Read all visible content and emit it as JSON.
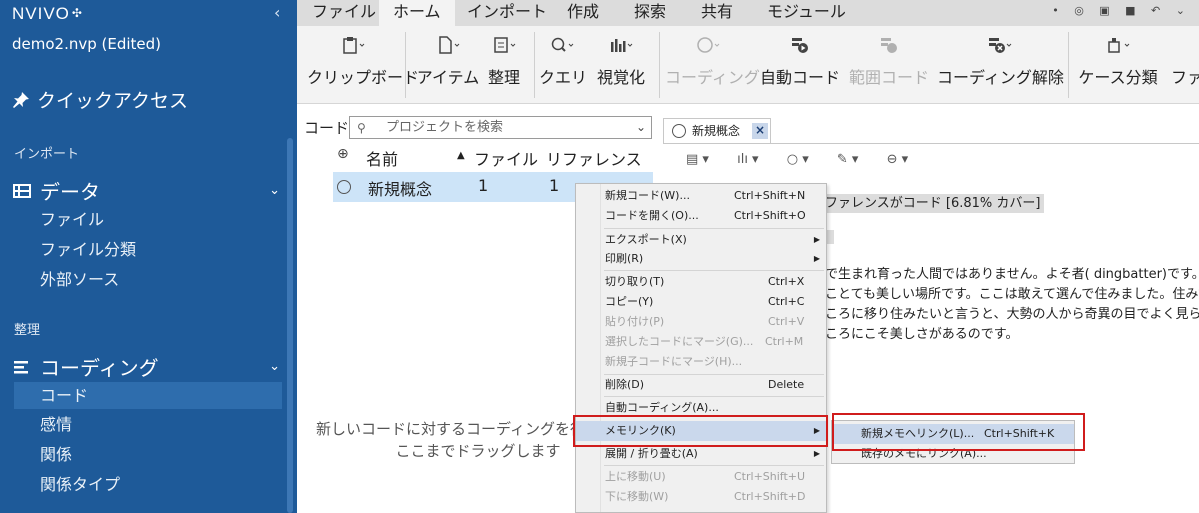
{
  "app": {
    "brand": "NVIVO",
    "project": "demo2.nvp (Edited)"
  },
  "sidebar": {
    "quick_access": "クイックアクセス",
    "section_import": "インポート",
    "group_data": "データ",
    "data_items": [
      "ファイル",
      "ファイル分類",
      "外部ソース"
    ],
    "section_organize": "整理",
    "group_coding": "コーディング",
    "coding_items": [
      "コード",
      "感情",
      "関係",
      "関係タイプ"
    ],
    "selected_item": "コード"
  },
  "tabs": [
    "ファイル",
    "ホーム",
    "インポート",
    "作成",
    "探索",
    "共有",
    "モジュール"
  ],
  "active_tab": "ホーム",
  "ribbon": [
    "クリップボード",
    "アイテム",
    "整理",
    "クエリ",
    "視覚化",
    "コーディング",
    "自動コード",
    "範囲コード",
    "コーディング解除",
    "ケース分類",
    "ファイ"
  ],
  "list": {
    "title": "コード",
    "search_placeholder": "プロジェクトを検索",
    "columns": [
      "名前",
      "ファイル",
      "リファレンス"
    ],
    "rows": [
      {
        "name": "新規概念",
        "files": "1",
        "refs": "1"
      }
    ],
    "drop_hint_line1": "新しいコードに対するコーディングを行う",
    "drop_hint_line2": "ここまでドラッグします"
  },
  "doc": {
    "tab_title": "新規概念",
    "summary": "ファレンスがコード [6.81% カバー]",
    "lines": [
      "で生まれ育った人間ではありません。よそ者( dingbatter)です。",
      "ことても美しい場所です。ここは敢えて選んで住みました。住み始",
      "ころに移り住みたいと言うと、大勢の人から奇異の目でよく見られま",
      "ころにこそ美しさがあるのです。"
    ]
  },
  "context_menu": [
    {
      "label": "新規コード(W)...",
      "shortcut": "Ctrl+Shift+N"
    },
    {
      "label": "コードを開く(O)...",
      "shortcut": "Ctrl+Shift+O"
    },
    {
      "label": "エクスポート(X)",
      "submenu": true
    },
    {
      "label": "印刷(R)",
      "submenu": true
    },
    {
      "label": "切り取り(T)",
      "shortcut": "Ctrl+X"
    },
    {
      "label": "コピー(Y)",
      "shortcut": "Ctrl+C"
    },
    {
      "label": "貼り付け(P)",
      "shortcut": "Ctrl+V",
      "disabled": true
    },
    {
      "label": "選択したコードにマージ(G)...",
      "shortcut": "Ctrl+M",
      "disabled": true
    },
    {
      "label": "新規子コードにマージ(H)...",
      "disabled": true
    },
    {
      "label": "削除(D)",
      "shortcut": "Delete"
    },
    {
      "label": "自動コーディング(A)..."
    },
    {
      "label": "メモリンク(K)",
      "submenu": true,
      "highlighted": true
    },
    {
      "label": "展開 / 折り畳む(A)",
      "submenu": true
    },
    {
      "label": "上に移動(U)",
      "shortcut": "Ctrl+Shift+U",
      "disabled": true
    },
    {
      "label": "下に移動(W)",
      "shortcut": "Ctrl+Shift+D",
      "disabled": true
    }
  ],
  "submenu": [
    {
      "label": "新規メモへリンク(L)...",
      "shortcut": "Ctrl+Shift+K",
      "highlighted": true
    },
    {
      "label": "既存のメモにリンク(A)..."
    }
  ],
  "colors": {
    "sidebar": "#1e5a99",
    "highlight_box": "#d01c1c",
    "selection": "#cde4f8"
  }
}
